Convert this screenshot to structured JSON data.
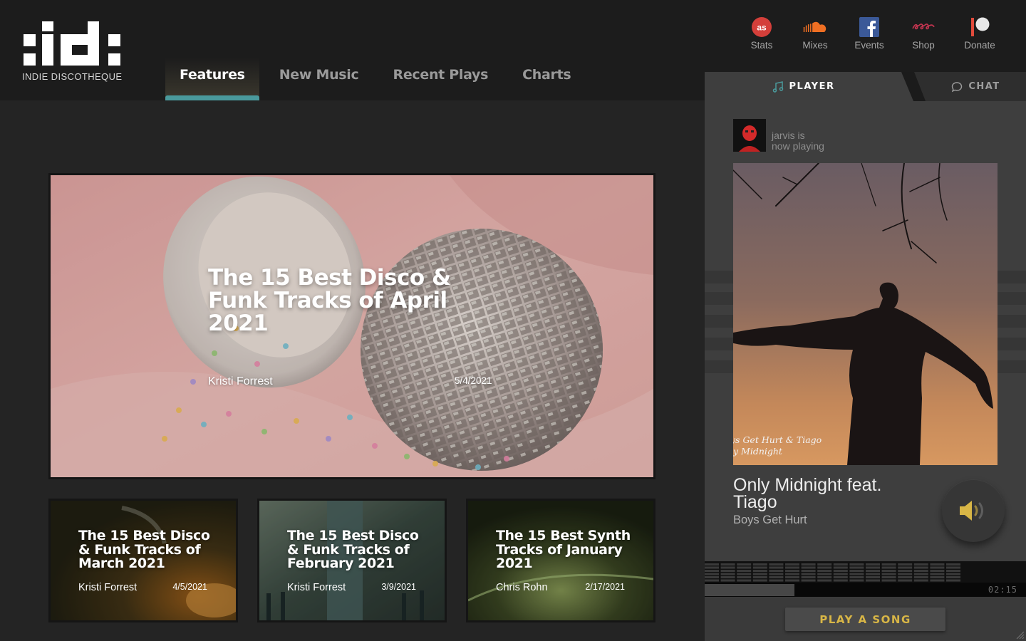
{
  "brand": {
    "logo_text": "INDIE DISCOTHEQUE"
  },
  "nav": [
    {
      "label": "Features",
      "active": true
    },
    {
      "label": "New Music",
      "active": false
    },
    {
      "label": "Recent Plays",
      "active": false
    },
    {
      "label": "Charts",
      "active": false
    }
  ],
  "social": [
    {
      "label": "Stats",
      "icon": "lastfm-icon"
    },
    {
      "label": "Mixes",
      "icon": "soundcloud-icon"
    },
    {
      "label": "Events",
      "icon": "facebook-icon"
    },
    {
      "label": "Shop",
      "icon": "bandcamp-shop-icon"
    },
    {
      "label": "Donate",
      "icon": "patreon-icon"
    }
  ],
  "hero": {
    "title": "The 15 Best Disco & Funk Tracks of April 2021",
    "author": "Kristi Forrest",
    "date": "5/4/2021"
  },
  "cards": [
    {
      "title": "The 15 Best Disco & Funk Tracks of March 2021",
      "author": "Kristi Forrest",
      "date": "4/5/2021"
    },
    {
      "title": "The 15 Best Disco & Funk Tracks of February 2021",
      "author": "Kristi Forrest",
      "date": "3/9/2021"
    },
    {
      "title": "The 15 Best Synth Tracks of January 2021",
      "author": "Chris Rohn",
      "date": "2/17/2021"
    }
  ],
  "player": {
    "tab_player": "PLAYER",
    "tab_chat": "CHAT",
    "user": "jarvis is",
    "status": "now playing",
    "art_caption_1": "ys Get Hurt & Tiago",
    "art_caption_2": "ly Midnight",
    "track_title": "Only Midnight feat. Tiago",
    "track_artist": "Boys Get Hurt",
    "time": "02:15",
    "progress": 0.28,
    "play_button": "PLAY A SONG"
  },
  "colors": {
    "accent_teal": "#4a9a9c",
    "play_gold": "#d8b646",
    "lastfm_red": "#d43f3a",
    "soundcloud_orange": "#ef6f23",
    "facebook_blue": "#3b5998",
    "shop_pink": "#c2344f",
    "patreon_red": "#e14b3c"
  }
}
